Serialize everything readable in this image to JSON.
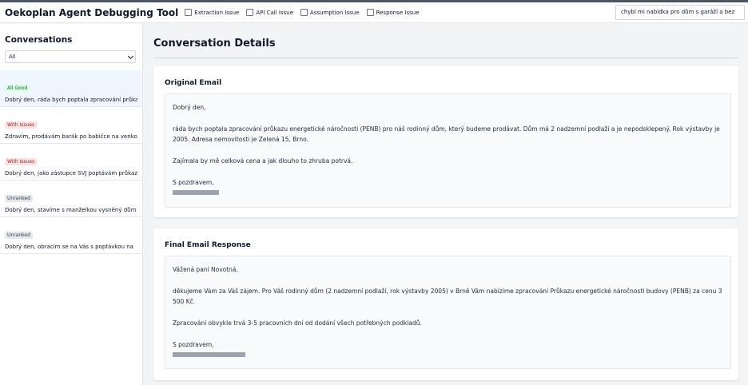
{
  "app": {
    "title": "Oekoplan Agent Debugging Tool"
  },
  "filters": [
    {
      "label": "Extraction Issue",
      "checked": false
    },
    {
      "label": "API Call Issue",
      "checked": false
    },
    {
      "label": "Assumption Issue",
      "checked": false
    },
    {
      "label": "Response Issue",
      "checked": false
    }
  ],
  "search": {
    "value": "chybí mi nabídka pro dům s garáží a bez"
  },
  "sidebar": {
    "title": "Conversations",
    "filter_value": "All",
    "conversations": [
      {
        "badge": "All Good",
        "status": "good",
        "preview": "Dobrý den, ráda bych poptala zpracování průkazu energetické náročnosti",
        "active": true
      },
      {
        "badge": "With Issues",
        "status": "issues",
        "preview": "Zdravím, prodávám barák po babičce na venkově",
        "active": false
      },
      {
        "badge": "With Issues",
        "status": "issues",
        "preview": "Dobrý den, jako zástupce SVJ poptávám průkaz",
        "active": false
      },
      {
        "badge": "Unranked",
        "status": "unranked",
        "preview": "Dobrý den, stavíme s manželkou vysněný dům",
        "active": false
      },
      {
        "badge": "Unranked",
        "status": "unranked",
        "preview": "Dobrý den, obracím se na Vás s poptávkou na",
        "active": false
      }
    ]
  },
  "main": {
    "title": "Conversation Details",
    "original": {
      "title": "Original Email",
      "greeting": "Dobrý den,",
      "body1": "ráda bych poptala zpracování průkazu energetické náročnosti (PENB) pro náš rodinný dům, který budeme prodávat. Dům má 2 nadzemní podlaží a je nepodsklepený. Rok výstavby je 2005. Adresa nemovitosti je Zelená 15, Brno.",
      "body2": "Zajímala by mě celková cena a jak dlouho to zhruba potrvá.",
      "closing": "S pozdravem,"
    },
    "response": {
      "title": "Final Email Response",
      "greeting": "Vážená paní Novotná,",
      "body1": "děkujeme Vám za Váš zájem. Pro Váš rodinný dům (2 nadzemní podlaží, rok výstavby 2005) v Brně Vám nabízíme zpracování Průkazu energetické náročnosti budovy (PENB) za cenu 3 500 Kč.",
      "body2": "Zpracování obvykle trvá 3-5 pracovních dní od dodání všech potřebných podkladů.",
      "closing": "S pozdravem,"
    }
  }
}
